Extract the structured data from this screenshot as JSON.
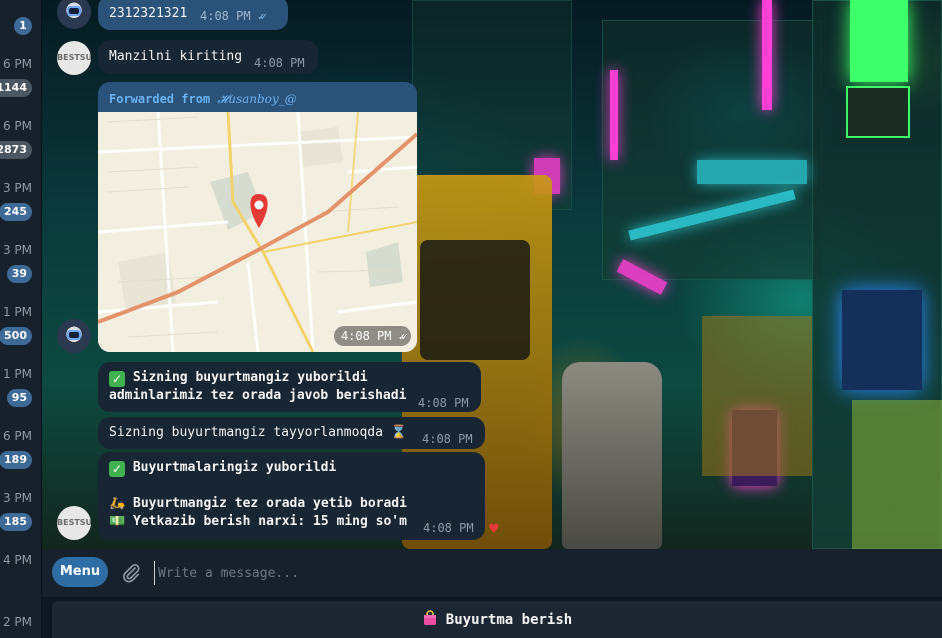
{
  "chat_list_strip": [
    {
      "time": "",
      "badge": "1",
      "muted": false
    },
    {
      "time": "6 PM",
      "badge": "1144",
      "muted": true
    },
    {
      "time": "6 PM",
      "badge": "2873",
      "muted": true
    },
    {
      "time": "3 PM",
      "badge": "245",
      "muted": false
    },
    {
      "time": "3 PM",
      "badge": "39",
      "muted": false
    },
    {
      "time": "1 PM",
      "badge": "500",
      "muted": false
    },
    {
      "time": "1 PM",
      "badge": "95",
      "muted": false
    },
    {
      "time": "6 PM",
      "badge": "189",
      "muted": false
    },
    {
      "time": "3 PM",
      "badge": "185",
      "muted": false
    },
    {
      "time": "4 PM",
      "badge": "",
      "muted": false
    },
    {
      "time": "2 PM",
      "badge": "",
      "muted": false
    }
  ],
  "messages": {
    "phone": {
      "text": "2312321321",
      "time": "4:08 PM"
    },
    "address_prompt": {
      "text": "Manzilni kiriting",
      "time": "4:08 PM"
    },
    "location": {
      "forwarded_label": "Forwarded from",
      "forwarded_name": "𝓗usanboy_@",
      "time": "4:08 PM"
    },
    "order_sent": {
      "line1": "Sizning buyurtmangiz yuborildi",
      "line2": "adminlarimiz tez orada javob berishadi",
      "time": "4:08 PM"
    },
    "order_preparing": {
      "text": "Sizning buyurtmangiz tayyorlanmoqda",
      "time": "4:08 PM"
    },
    "orders_sent": {
      "line1": "Buyurtmalaringiz yuborildi",
      "line2": "Buyurtmangiz tez orada yetib boradi",
      "line3": "Yetkazib berish narxi: 15 ming so'm",
      "time": "4:08 PM"
    }
  },
  "avatar_logo_text": "BESTSUT",
  "input_bar": {
    "menu_label": "Menu",
    "placeholder": "Write a message..."
  },
  "keyboard": {
    "button_label": "Buyurtma berish"
  },
  "colors": {
    "incoming_bubble": "#182533",
    "outgoing_bubble": "#2b5278",
    "accent": "#6ab3f3",
    "menu_button": "#2f6ea5"
  }
}
